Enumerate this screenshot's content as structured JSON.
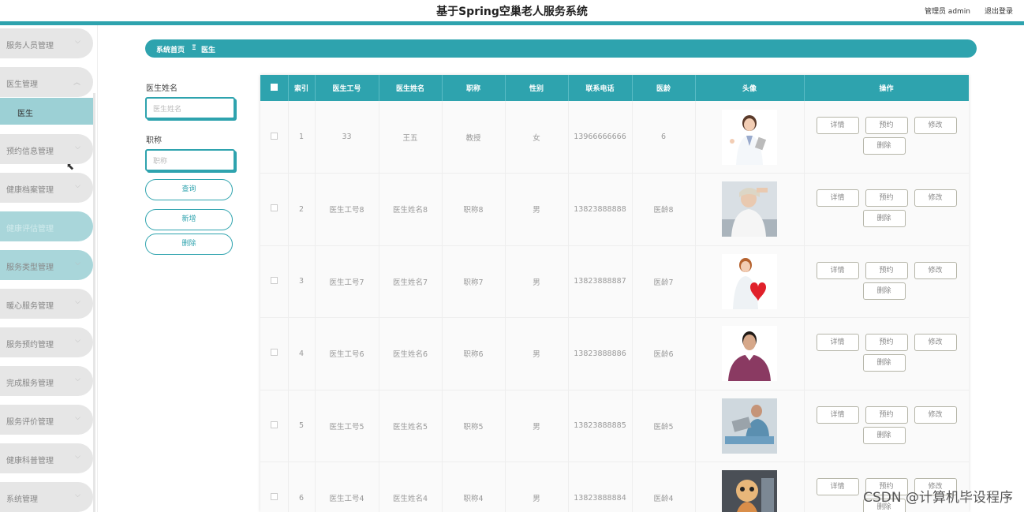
{
  "header": {
    "title": "基于Spring空巢老人服务系统",
    "admin": "管理员 admin",
    "logout": "退出登录"
  },
  "sidebar": {
    "items": [
      {
        "label": "服务人员管理"
      },
      {
        "label": "医生管理"
      },
      {
        "label": "预约信息管理"
      },
      {
        "label": "健康档案管理"
      },
      {
        "label": "健康评估管理"
      },
      {
        "label": "服务类型管理"
      },
      {
        "label": "暖心服务管理"
      },
      {
        "label": "服务预约管理"
      },
      {
        "label": "完成服务管理"
      },
      {
        "label": "服务评价管理"
      },
      {
        "label": "健康科普管理"
      },
      {
        "label": "系统管理"
      }
    ],
    "sub_item": "医生"
  },
  "breadcrumb": {
    "home": "系统首页",
    "sep": "Ξ",
    "current": "医生"
  },
  "search": {
    "name_label": "医生姓名",
    "name_placeholder": "医生姓名",
    "title_label": "职称",
    "title_placeholder": "职称",
    "query": "查询",
    "add": "新增",
    "delete": "删除"
  },
  "table": {
    "headers": [
      "索引",
      "医生工号",
      "医生姓名",
      "职称",
      "性别",
      "联系电话",
      "医龄",
      "头像",
      "操作"
    ],
    "actions": {
      "detail": "详情",
      "book": "预约",
      "edit": "修改",
      "remove": "删除"
    },
    "rows": [
      {
        "index": "1",
        "no": "33",
        "name": "王五",
        "title": "教授",
        "gender": "女",
        "phone": "13966666666",
        "years": "6",
        "avatar": "female-doctor-tablet"
      },
      {
        "index": "2",
        "no": "医生工号8",
        "name": "医生姓名8",
        "title": "职称8",
        "gender": "男",
        "phone": "13823888888",
        "years": "医龄8",
        "avatar": "female-doctor-office"
      },
      {
        "index": "3",
        "no": "医生工号7",
        "name": "医生姓名7",
        "title": "职称7",
        "gender": "男",
        "phone": "13823888887",
        "years": "医龄7",
        "avatar": "nurse-heart"
      },
      {
        "index": "4",
        "no": "医生工号6",
        "name": "医生姓名6",
        "title": "职称6",
        "gender": "男",
        "phone": "13823888886",
        "years": "医龄6",
        "avatar": "man-purple-sweater"
      },
      {
        "index": "5",
        "no": "医生工号5",
        "name": "医生姓名5",
        "title": "职称5",
        "gender": "男",
        "phone": "13823888885",
        "years": "医龄5",
        "avatar": "doctor-laptop"
      },
      {
        "index": "6",
        "no": "医生工号4",
        "name": "医生姓名4",
        "title": "职称4",
        "gender": "男",
        "phone": "13823888884",
        "years": "医龄4",
        "avatar": "toy-figure"
      }
    ]
  },
  "watermark": "CSDN @计算机毕设程序",
  "colors": {
    "accent": "#2ea3ae"
  }
}
